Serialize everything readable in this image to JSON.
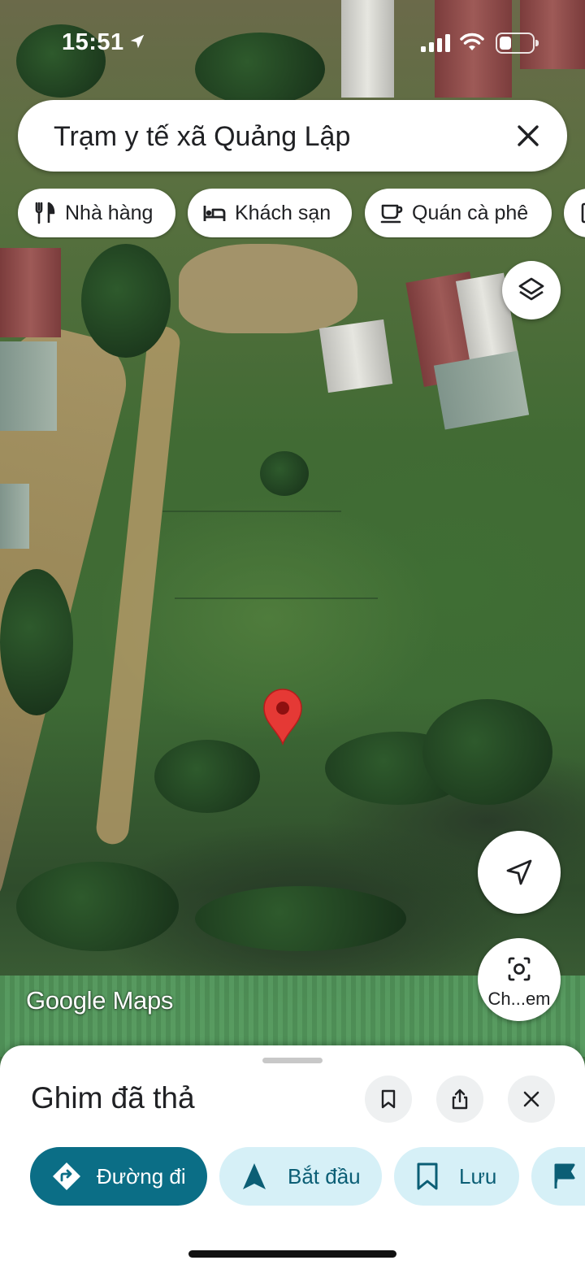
{
  "status_bar": {
    "time": "15:51"
  },
  "search": {
    "query": "Trạm y tế xã Quảng Lập"
  },
  "chips": [
    {
      "label": "Nhà hàng",
      "icon": "restaurant-icon"
    },
    {
      "label": "Khách sạn",
      "icon": "hotel-icon"
    },
    {
      "label": "Quán cà phê",
      "icon": "coffee-icon"
    }
  ],
  "map": {
    "attribution": "Google Maps",
    "lens_label": "Ch...em"
  },
  "sheet": {
    "title": "Ghim đã thả",
    "actions": {
      "directions": "Đường đi",
      "start": "Bắt đầu",
      "save": "Lưu"
    }
  },
  "colors": {
    "accent": "#0b6e86",
    "secondary_button": "#d6f0f7",
    "pin": "#e53935"
  }
}
